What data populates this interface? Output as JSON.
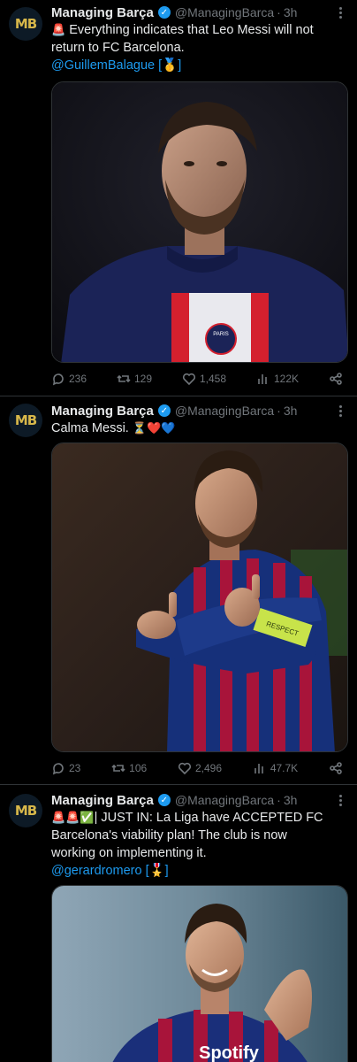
{
  "tweets": [
    {
      "avatar_label": "MB",
      "name": "Managing Barça",
      "handle": "@ManagingBarca",
      "separator": "·",
      "time": "3h",
      "line1_emoji": "🚨",
      "line1": "Everything indicates that Leo Messi will not",
      "line2": "return to FC Barcelona.",
      "mention": "@GuillemBalague",
      "mention_tail": "[🥇]",
      "replies": "236",
      "retweets": "129",
      "likes": "1,458",
      "views": "122K"
    },
    {
      "avatar_label": "MB",
      "name": "Managing Barça",
      "handle": "@ManagingBarca",
      "separator": "·",
      "time": "3h",
      "line1": "Calma Messi.",
      "line1_emoji": "⏳❤️💙",
      "replies": "23",
      "retweets": "106",
      "likes": "2,496",
      "views": "47.7K"
    },
    {
      "avatar_label": "MB",
      "name": "Managing Barça",
      "handle": "@ManagingBarca",
      "separator": "·",
      "time": "3h",
      "line1_emoji": "🚨🚨✅",
      "line1": "| JUST IN: La Liga have ACCEPTED FC",
      "line2": "Barcelona's viability plan! The club is now",
      "line3": "working on implementing it.",
      "mention": "@gerardromero",
      "mention_tail": "[🎖️]"
    }
  ],
  "images": {
    "psg_badge": "PARIS",
    "captain_band": "RESPECT",
    "sponsor": "Spotify"
  },
  "colors": {
    "background": "#000000",
    "text": "#e7e9ea",
    "muted": "#71767b",
    "link": "#1d9bf0",
    "divider": "#2f3336"
  }
}
